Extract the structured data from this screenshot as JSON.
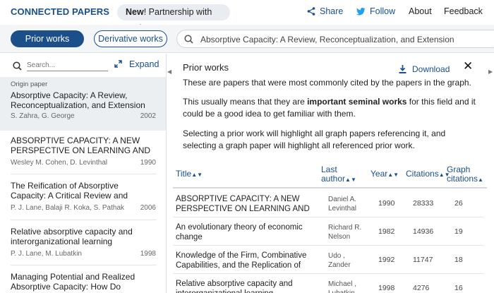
{
  "header": {
    "brand": "CONNECTED PAPERS",
    "promo_bold": "New",
    "promo_rest": "! Partnership with arXiv",
    "share": "Share",
    "follow": "Follow",
    "about": "About",
    "feedback": "Feedback"
  },
  "toolbar": {
    "prior_works": "Prior works",
    "derivative_works": "Derivative works",
    "search_value": "Absorptive Capacity: A Review, Reconceptualization, and Extension"
  },
  "left": {
    "search_placeholder": "Search...",
    "expand": "Expand",
    "origin": {
      "label": "Origin paper",
      "title": "Absorptive Capacity: A Review, Reconceptualization, and Extension",
      "authors": "S. Zahra, G. George",
      "year": "2002"
    },
    "items": [
      {
        "title": "ABSORPTIVE CAPACITY: A NEW PERSPECTIVE ON LEARNING AND INNOVATION",
        "authors": "Wesley M. Cohen, D. Levinthal",
        "year": "1990"
      },
      {
        "title": "The Reification of Absorptive Capacity: A Critical Review and Rejuvenation of the Construct",
        "authors": "P. J. Lane, Balaji R. Koka, S. Pathak",
        "year": "2006"
      },
      {
        "title": "Relative absorptive capacity and interorganizational learning",
        "authors": "P. J. Lane, M. Lubatkin",
        "year": "1998"
      },
      {
        "title": "Managing Potential and Realized Absorptive Capacity: How Do Organizational Antecedents Matter?",
        "authors": "",
        "year": ""
      }
    ]
  },
  "panel": {
    "title": "Prior works",
    "download": "Download",
    "p1": "These are papers that were most commonly cited by the papers in the graph.",
    "p2_a": "This usually means that they are ",
    "p2_b": "important seminal works",
    "p2_c": " for this field and it could be a good idea to get familiar with them.",
    "p3": "Selecting a prior work will highlight all graph papers referencing it, and selecting a graph paper will highlight all referenced prior work.",
    "columns": {
      "title": "Title",
      "last_author_1": "Last",
      "last_author_2": "author",
      "year": "Year",
      "citations": "Citations",
      "graph_1": "Graph",
      "graph_2": "citations"
    },
    "rows": [
      {
        "title": "ABSORPTIVE CAPACITY: A NEW PERSPECTIVE ON LEARNING AND INNOVATION",
        "author": "Daniel A. Levinthal",
        "year": "1990",
        "citations": "28333",
        "graph": "26"
      },
      {
        "title": "An evolutionary theory of economic change",
        "author": "Richard R. Nelson",
        "year": "1982",
        "citations": "14936",
        "graph": "19"
      },
      {
        "title": "Knowledge of the Firm, Combinative Capabilities, and the Replication of Technology",
        "author": "Udo , Zander",
        "year": "1992",
        "citations": "11747",
        "graph": "18"
      },
      {
        "title": "Relative absorptive capacity and interorganizational learning",
        "author": "Michael , Lubatkin",
        "year": "1998",
        "citations": "4276",
        "graph": "16"
      }
    ]
  },
  "colors": {
    "brand": "#1a4f8a",
    "panel_bg": "#eceff2"
  }
}
